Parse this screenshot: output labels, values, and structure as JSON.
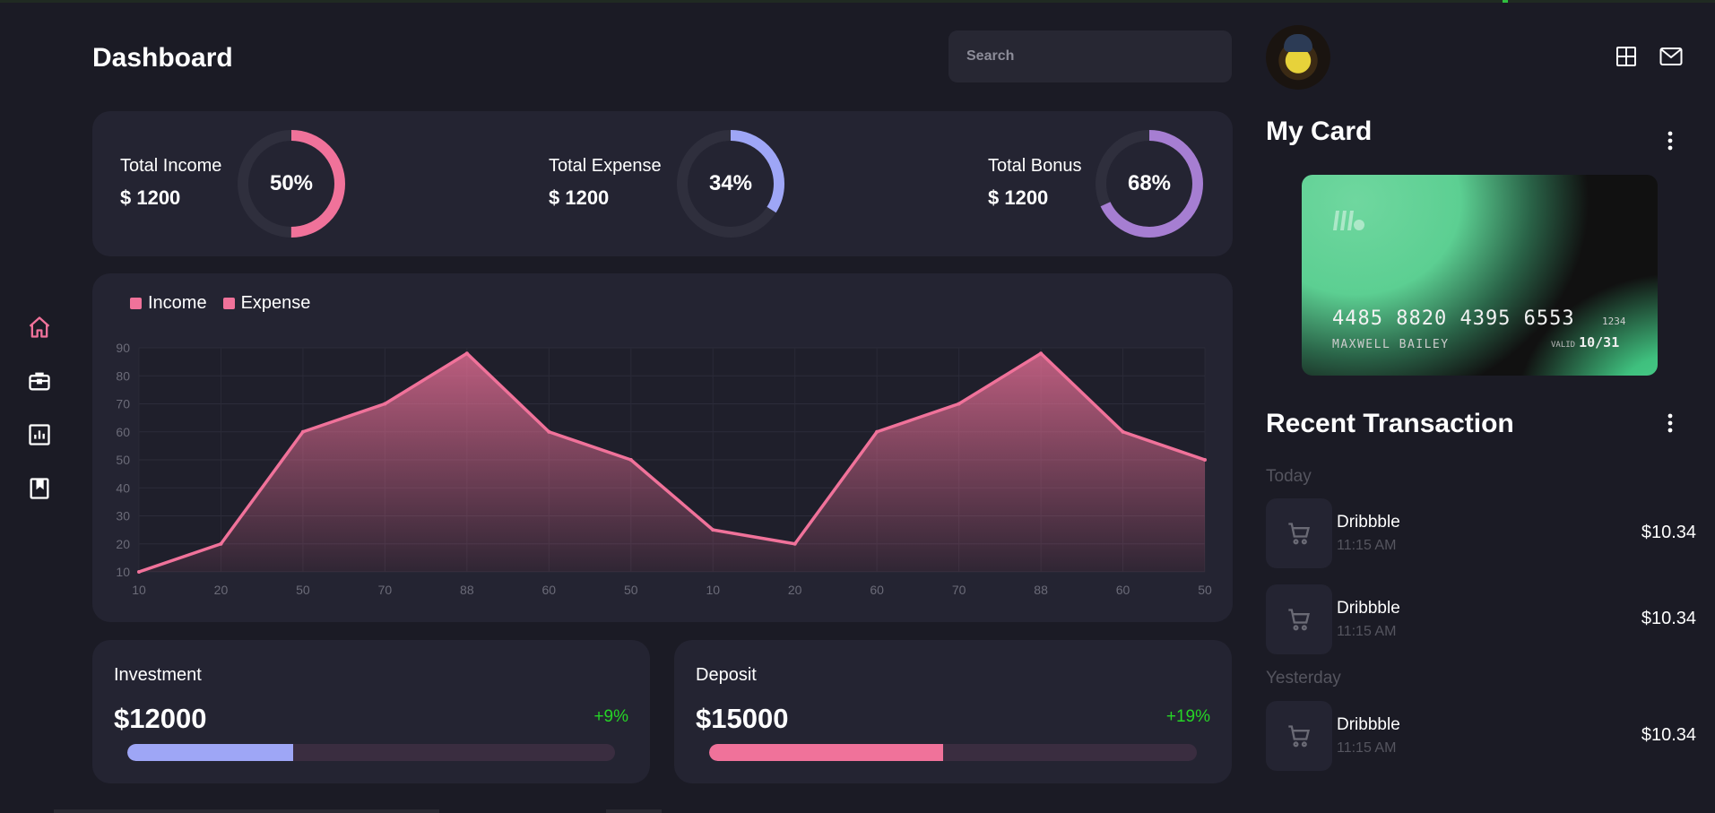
{
  "header": {
    "title": "Dashboard",
    "search_placeholder": "Search"
  },
  "sidebar": {
    "items": [
      {
        "name": "home",
        "active": true
      },
      {
        "name": "briefcase",
        "active": false
      },
      {
        "name": "chart",
        "active": false
      },
      {
        "name": "bookmark-book",
        "active": false
      }
    ]
  },
  "stats": [
    {
      "label": "Total Income",
      "value": "$ 1200",
      "percent_label": "50%",
      "percent": 50,
      "color": "#f0729a"
    },
    {
      "label": "Total Expense",
      "value": "$ 1200",
      "percent_label": "34%",
      "percent": 34,
      "color": "#9ea6f6"
    },
    {
      "label": "Total Bonus",
      "value": "$ 1200",
      "percent_label": "68%",
      "percent": 68,
      "color": "#a67ed2"
    }
  ],
  "chart_data": {
    "type": "area",
    "legend": [
      {
        "name": "Income",
        "color": "#f0729a"
      },
      {
        "name": "Expense",
        "color": "#f0729a"
      }
    ],
    "categories": [
      "10",
      "20",
      "50",
      "70",
      "88",
      "60",
      "50",
      "10",
      "20",
      "60",
      "70",
      "88",
      "60",
      "50"
    ],
    "series": [
      {
        "name": "Income",
        "values": [
          10,
          20,
          60,
          70,
          88,
          60,
          50,
          25,
          20,
          60,
          70,
          88,
          60,
          50
        ]
      }
    ],
    "y_ticks": [
      "10",
      "20",
      "30",
      "40",
      "50",
      "60",
      "70",
      "80",
      "90"
    ],
    "ylim": [
      10,
      90
    ],
    "line_color": "#f0729a",
    "grid": true
  },
  "investment": {
    "label": "Investment",
    "value": "$12000",
    "change": "+9%",
    "progress": 0.34,
    "color": "#9ea6f6"
  },
  "deposit": {
    "label": "Deposit",
    "value": "$15000",
    "change": "+19%",
    "progress": 0.48,
    "color": "#f0729a"
  },
  "right_panel": {
    "my_card_title": "My Card",
    "card": {
      "number": "4485 8820 4395 6553",
      "cvc": "1234",
      "holder": "MAXWELL BAILEY",
      "valid_label": "VALID",
      "valid_date": "10/31"
    },
    "transactions_title": "Recent Transaction",
    "groups": [
      {
        "label": "Today",
        "items": [
          {
            "name": "Dribbble",
            "time": "11:15 AM",
            "amount": "$10.34"
          },
          {
            "name": "Dribbble",
            "time": "11:15 AM",
            "amount": "$10.34"
          }
        ]
      },
      {
        "label": "Yesterday",
        "items": [
          {
            "name": "Dribbble",
            "time": "11:15 AM",
            "amount": "$10.34"
          }
        ]
      }
    ]
  }
}
